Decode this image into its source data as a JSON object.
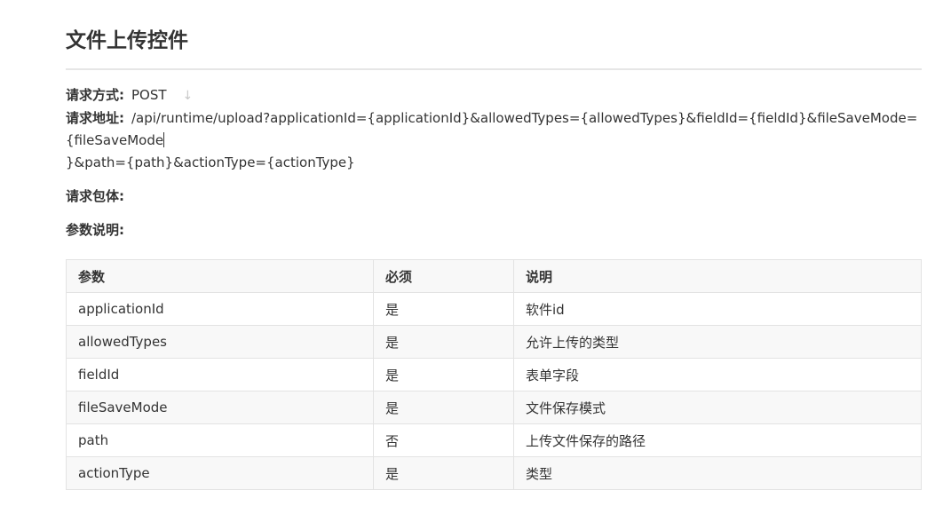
{
  "page": {
    "title": "文件上传控件"
  },
  "request": {
    "method_label": "请求方式:",
    "method_value": "POST",
    "method_arrow": "↓",
    "url_label": "请求地址:",
    "url_line1": "/api/runtime/upload?applicationId={applicationId}&allowedTypes={allowedTypes}&fieldId={fieldId}&fileSaveMode=",
    "url_line2": "{fileSaveMode",
    "url_line3": "}&path={path}&actionType={actionType}",
    "body_label": "请求包体:",
    "params_label": "参数说明:"
  },
  "table": {
    "headers": [
      "参数",
      "必须",
      "说明"
    ],
    "rows": [
      [
        "applicationId",
        "是",
        "软件id"
      ],
      [
        "allowedTypes",
        "是",
        "允许上传的类型"
      ],
      [
        "fieldId",
        "是",
        "表单字段"
      ],
      [
        "fileSaveMode",
        "是",
        "文件保存模式"
      ],
      [
        "path",
        "否",
        "上传文件保存的路径"
      ],
      [
        "actionType",
        "是",
        "类型"
      ]
    ]
  }
}
